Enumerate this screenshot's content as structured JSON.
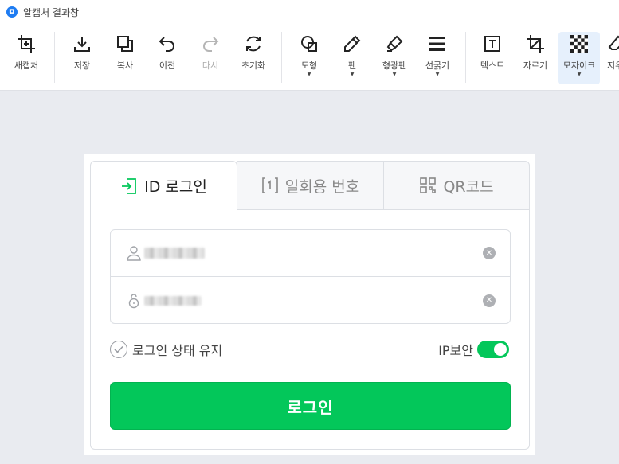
{
  "window": {
    "logo_glyph": "⧉",
    "title": "알캡처 결과창"
  },
  "toolbar": {
    "items": [
      {
        "id": "new-capture",
        "label": "새캡처",
        "icon": "crop-plus-icon"
      },
      {
        "id": "save",
        "label": "저장",
        "icon": "download-icon"
      },
      {
        "id": "copy",
        "label": "복사",
        "icon": "copy-icon"
      },
      {
        "id": "undo",
        "label": "이전",
        "icon": "undo-icon"
      },
      {
        "id": "redo",
        "label": "다시",
        "icon": "redo-icon",
        "disabled": true
      },
      {
        "id": "reset",
        "label": "초기화",
        "icon": "refresh-icon"
      },
      {
        "id": "shape",
        "label": "도형",
        "icon": "shape-icon",
        "dropdown": true
      },
      {
        "id": "pen",
        "label": "펜",
        "icon": "pen-icon",
        "dropdown": true
      },
      {
        "id": "highlighter",
        "label": "형광펜",
        "icon": "highlighter-icon",
        "dropdown": true
      },
      {
        "id": "line-width",
        "label": "선굵기",
        "icon": "line-width-icon",
        "dropdown": true
      },
      {
        "id": "text",
        "label": "텍스트",
        "icon": "text-icon"
      },
      {
        "id": "crop",
        "label": "자르기",
        "icon": "crop-icon"
      },
      {
        "id": "mosaic",
        "label": "모자이크",
        "icon": "mosaic-icon",
        "dropdown": true,
        "active": true
      },
      {
        "id": "eraser",
        "label": "지우",
        "icon": "eraser-icon"
      }
    ]
  },
  "login": {
    "tabs": [
      {
        "label": "ID 로그인",
        "icon": "login-arrow-icon",
        "active": true
      },
      {
        "label": "일회용 번호",
        "icon": "one-time-number-icon"
      },
      {
        "label": "QR코드",
        "icon": "qr-code-icon"
      }
    ],
    "id_field_icon": "user-icon",
    "password_field_icon": "lock-icon",
    "clear_glyph": "✕",
    "keep_logged_in": "로그인 상태 유지",
    "ip_security": "IP보안",
    "ip_security_on": true,
    "submit": "로그인"
  },
  "colors": {
    "accent": "#03c75a",
    "app_blue": "#1e7cf2",
    "active_tool_bg": "#e6f0fc"
  }
}
